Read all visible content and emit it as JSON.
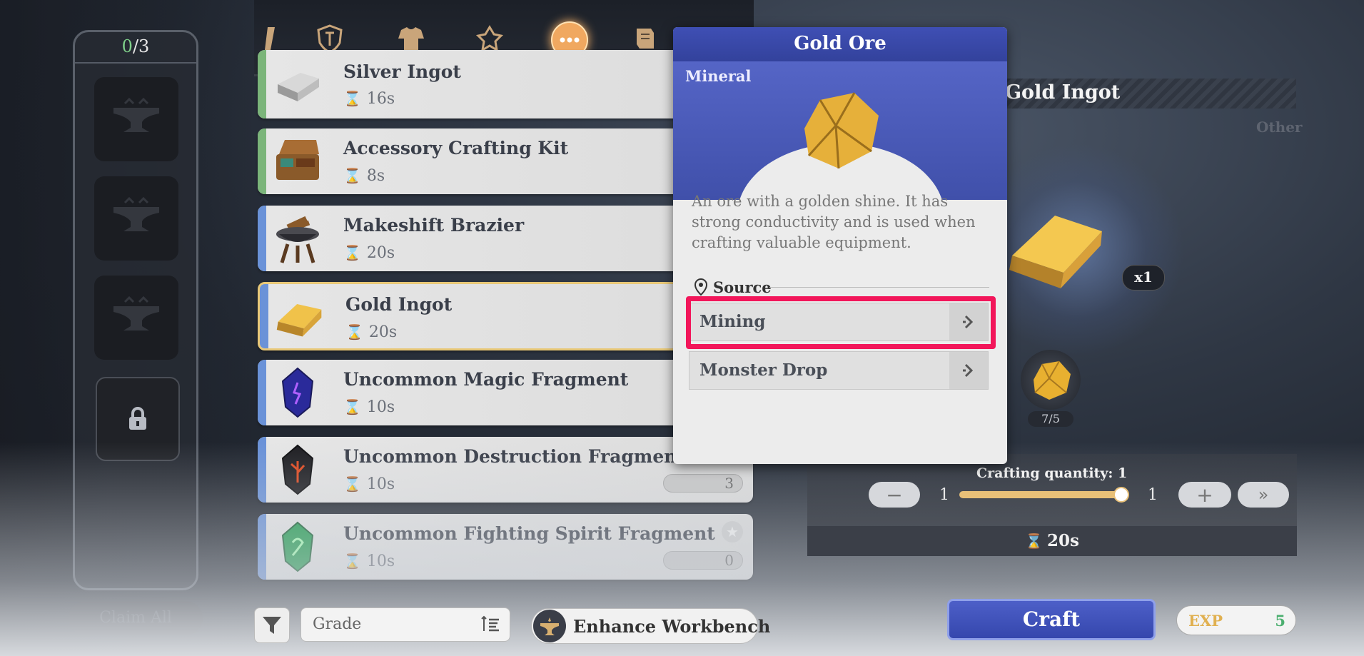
{
  "queue": {
    "used": "0",
    "total": "/3",
    "claim_label": "Claim All"
  },
  "tabs": [
    {
      "icon": "partial-tool-icon"
    },
    {
      "icon": "shield-icon"
    },
    {
      "icon": "armor-icon"
    },
    {
      "icon": "accessory-icon"
    },
    {
      "icon": "more-icon",
      "active": true
    },
    {
      "icon": "scroll-icon"
    }
  ],
  "recipes": [
    {
      "name": "Silver Ingot",
      "time": "16s"
    },
    {
      "name": "Accessory Crafting Kit",
      "time": "8s"
    },
    {
      "name": "Makeshift Brazier",
      "time": "20s"
    },
    {
      "name": "Gold Ingot",
      "time": "20s"
    },
    {
      "name": "Uncommon Magic Fragment",
      "time": "10s"
    },
    {
      "name": "Uncommon Destruction Fragment",
      "time": "10s",
      "owned": "3"
    },
    {
      "name": "Uncommon Fighting Spirit Fragment",
      "time": "10s",
      "owned": "0"
    }
  ],
  "controls": {
    "grade_label": "Grade",
    "enhance_label": "Enhance Workbench"
  },
  "detail": {
    "title": "Gold Ingot",
    "category": "Other",
    "output_qty": "x1",
    "material_count": "7/5",
    "qty_label": "Crafting quantity: 1",
    "qty_min": "1",
    "qty_max": "1",
    "craft_time": "20s",
    "craft_label": "Craft",
    "exp_label": "EXP",
    "exp_value": "5"
  },
  "popup": {
    "title": "Gold Ore",
    "category": "Mineral",
    "description": "An ore with a golden shine. It has strong conductivity and is used when crafting valuable equipment.",
    "source_label": "Source",
    "sources": [
      "Mining",
      "Monster Drop"
    ]
  },
  "colors": {
    "accent": "#3f4fb4",
    "highlight": "#f2165a",
    "gold": "#e8c078",
    "exp": "#4caf70"
  }
}
